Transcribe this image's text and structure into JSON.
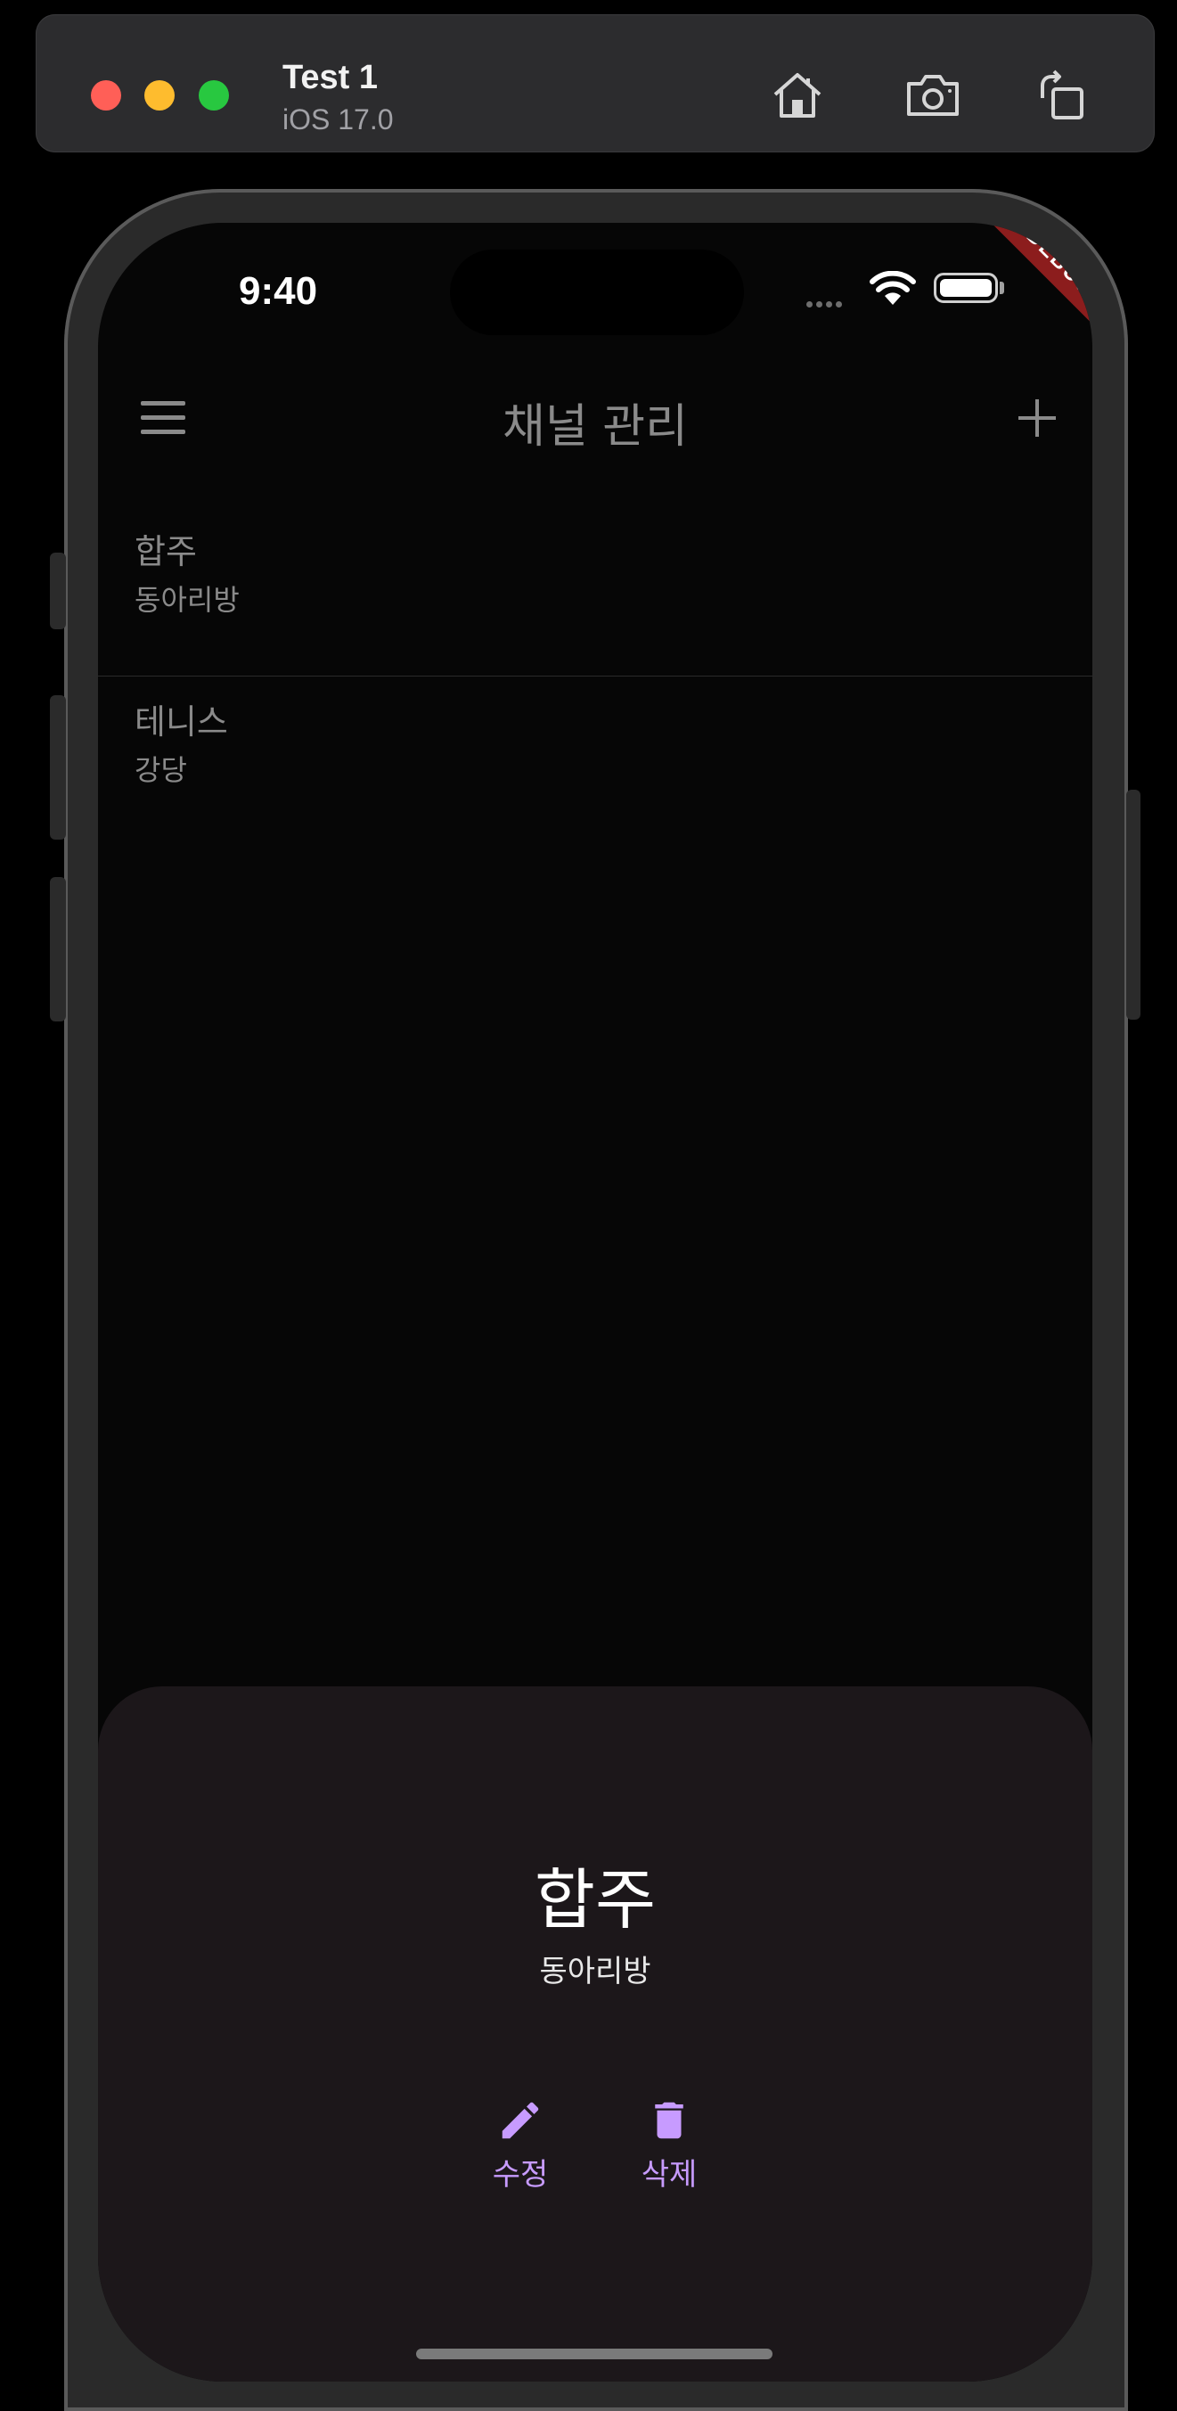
{
  "simulator": {
    "device_name": "Test 1",
    "os_version": "iOS 17.0",
    "icons": [
      "home-icon",
      "screenshot-icon",
      "rotate-icon"
    ]
  },
  "status_bar": {
    "time": "9:40",
    "debug_banner": "DEBUG"
  },
  "app_bar": {
    "title": "채널 관리",
    "menu_icon": "menu-icon",
    "add_icon": "add-icon"
  },
  "channels": [
    {
      "name": "합주",
      "location": "동아리방"
    },
    {
      "name": "테니스",
      "location": "강당"
    }
  ],
  "bottom_sheet": {
    "title": "합주",
    "subtitle": "동아리방",
    "actions": [
      {
        "label": "수정",
        "icon": "edit-icon"
      },
      {
        "label": "삭제",
        "icon": "trash-icon"
      }
    ],
    "accent_color": "#c79bff"
  },
  "colors": {
    "background": "#060606",
    "sheet_background": "#1c171a",
    "muted_text": "#8a8a8a",
    "debug_banner": "#8c1d1d"
  }
}
